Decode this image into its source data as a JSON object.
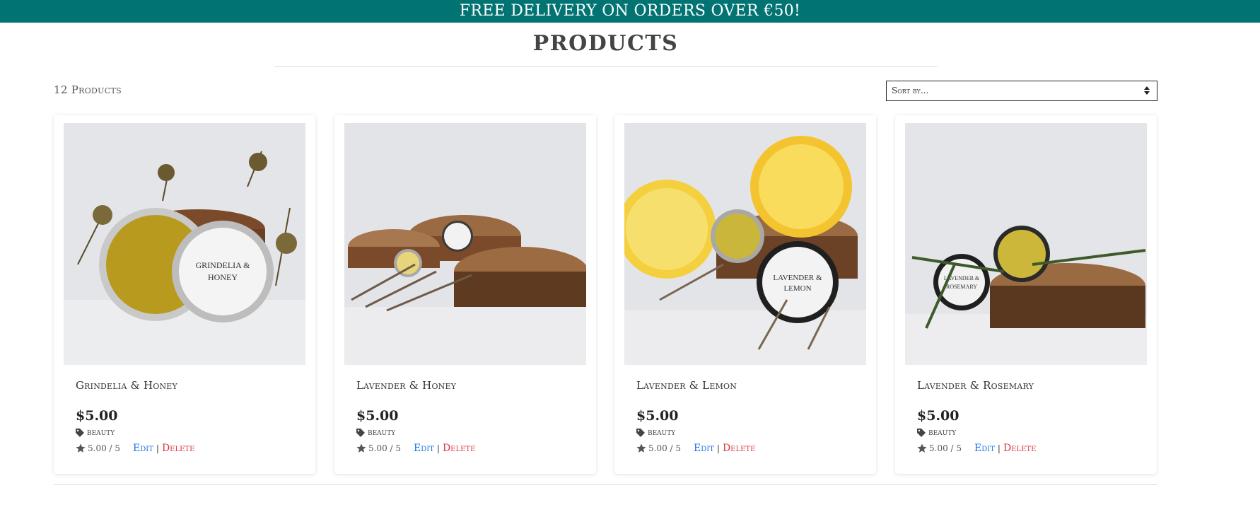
{
  "banner": {
    "text": "FREE DELIVERY ON ORDERS OVER €50!"
  },
  "page": {
    "title": "PRODUCTS",
    "product_count": "12 Products"
  },
  "sort": {
    "selected": "Sort by..."
  },
  "colors": {
    "banner_bg": "#017373",
    "edit_link": "#1a73e8",
    "delete_link": "#d9363e"
  },
  "products": [
    {
      "name": "Grindelia & Honey",
      "price": "$5.00",
      "category": "beauty",
      "rating": "5.00 / 5",
      "edit": "Edit",
      "sep": "|",
      "delete": "Delete",
      "image_icon": "balm-tin-grindelia-photo"
    },
    {
      "name": "Lavender & Honey",
      "price": "$5.00",
      "category": "beauty",
      "rating": "5.00 / 5",
      "edit": "Edit",
      "sep": "|",
      "delete": "Delete",
      "image_icon": "balm-tin-lavender-honey-photo"
    },
    {
      "name": "Lavender & Lemon",
      "price": "$5.00",
      "category": "beauty",
      "rating": "5.00 / 5",
      "edit": "Edit",
      "sep": "|",
      "delete": "Delete",
      "image_icon": "balm-tin-lemon-photo"
    },
    {
      "name": "Lavender & Rosemary",
      "price": "$5.00",
      "category": "beauty",
      "rating": "5.00 / 5",
      "edit": "Edit",
      "sep": "|",
      "delete": "Delete",
      "image_icon": "balm-tin-rosemary-photo"
    }
  ]
}
